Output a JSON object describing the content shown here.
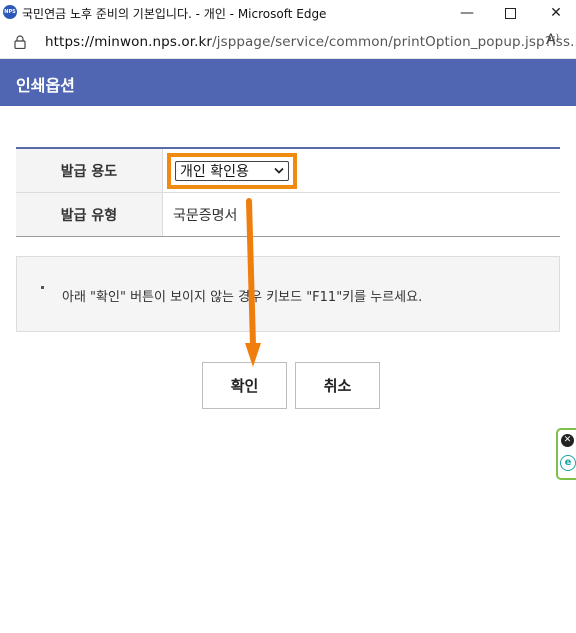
{
  "window": {
    "title": "국민연금 노후 준비의 기본입니다. - 개인 - Microsoft Edge",
    "favicon_text": "NPS",
    "minimize": "—",
    "close": "✕"
  },
  "address": {
    "host": "https://minwon.nps.or.kr",
    "path": "/jsppage/service/common/printOption_popup.jsp?iss...",
    "read_aloud": "A⁾"
  },
  "banner": {
    "title": "인쇄옵션",
    "color": "#5066b3"
  },
  "form": {
    "rows": [
      {
        "label": "발급 용도",
        "value": "개인 확인용"
      },
      {
        "label": "발급 유형",
        "value": "국문증명서"
      }
    ]
  },
  "notice": {
    "text": "아래 \"확인\" 버튼이 보이지 않는 경우 키보드 \"F11\"키를 누르세요."
  },
  "buttons": {
    "confirm": "확인",
    "cancel": "취소"
  },
  "side_widget": {
    "close_icon": "✕",
    "e_icon": "e"
  },
  "highlight_color": "#f08a10"
}
